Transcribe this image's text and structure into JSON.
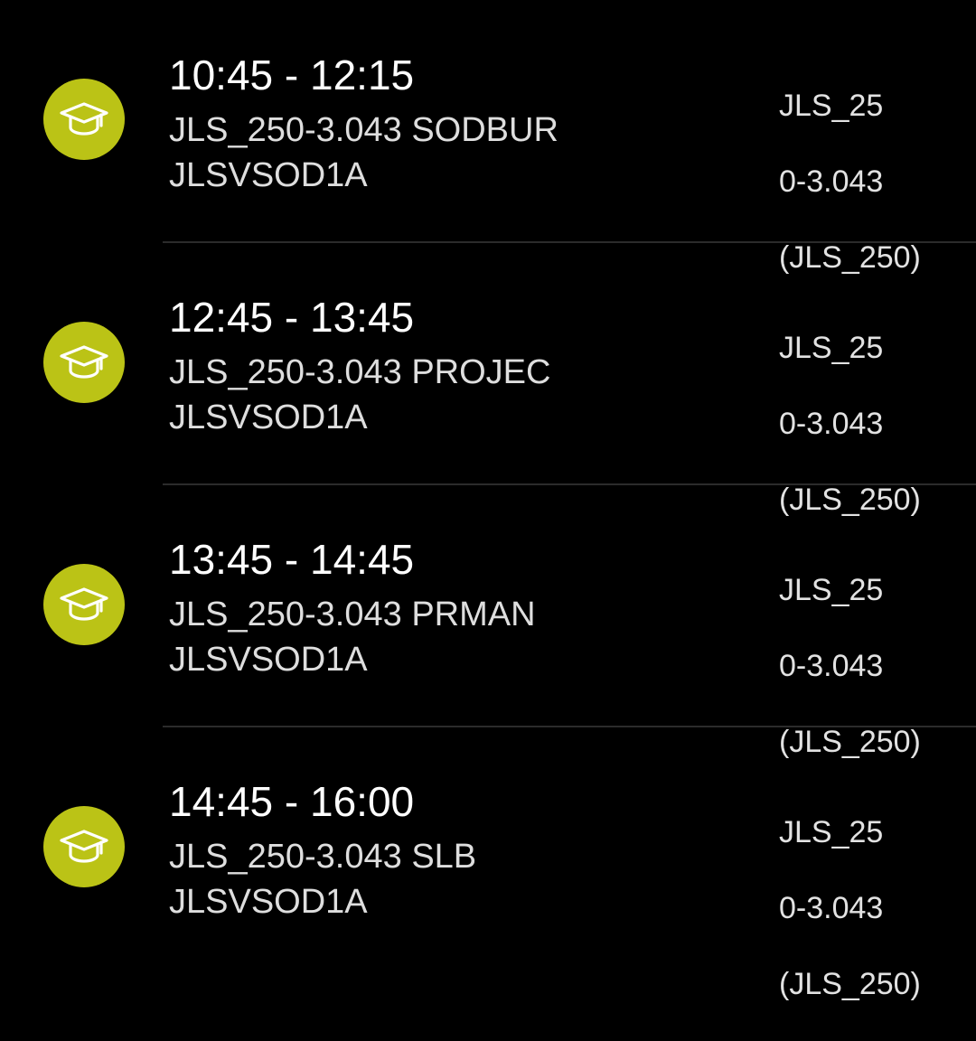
{
  "icon_color": "#bbc316",
  "icon_name": "graduation-cap-icon",
  "events": [
    {
      "time": "10:45 - 12:15",
      "title": "JLS_250-3.043 SODBUR",
      "group": "JLSVSOD1A",
      "meta": [
        "JLS_25",
        "0-3.043",
        "(JLS_250)"
      ]
    },
    {
      "time": "12:45 - 13:45",
      "title": "JLS_250-3.043 PROJEC",
      "group": "JLSVSOD1A",
      "meta": [
        "JLS_25",
        "0-3.043",
        "(JLS_250)"
      ]
    },
    {
      "time": "13:45 - 14:45",
      "title": "JLS_250-3.043 PRMAN",
      "group": "JLSVSOD1A",
      "meta": [
        "JLS_25",
        "0-3.043",
        "(JLS_250)"
      ]
    },
    {
      "time": "14:45 - 16:00",
      "title": "JLS_250-3.043 SLB",
      "group": "JLSVSOD1A",
      "meta": [
        "JLS_25",
        "0-3.043",
        "(JLS_250)"
      ]
    }
  ]
}
